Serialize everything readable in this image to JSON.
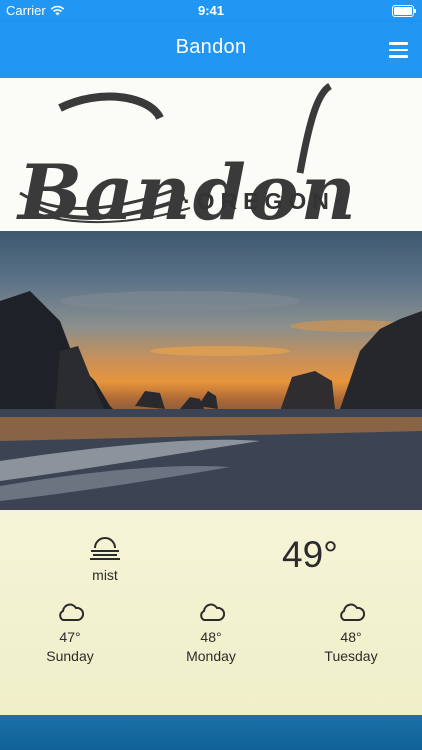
{
  "status": {
    "carrier": "Carrier",
    "time": "9:41"
  },
  "app_bar": {
    "title": "Bandon"
  },
  "logo": {
    "word": "Bandon",
    "sub": "·OREGON·"
  },
  "weather": {
    "current": {
      "icon": "mist-icon",
      "condition": "mist",
      "temp": "49°"
    },
    "forecast": [
      {
        "icon": "cloud-icon",
        "temp": "47°",
        "day": "Sunday"
      },
      {
        "icon": "cloud-icon",
        "temp": "48°",
        "day": "Monday"
      },
      {
        "icon": "cloud-icon",
        "temp": "48°",
        "day": "Tuesday"
      }
    ]
  },
  "colors": {
    "accent": "#2196f3",
    "footer": "#1166a0",
    "panel": "#f3f2d1"
  }
}
